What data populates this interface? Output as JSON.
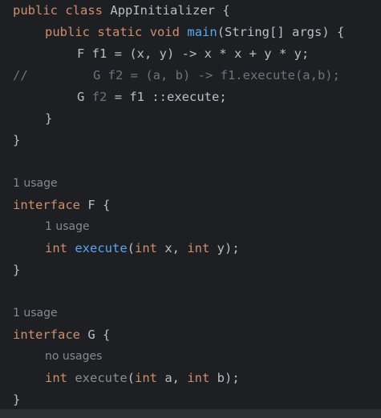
{
  "editor": {
    "lines": {
      "l1": {
        "kw1": "public",
        "kw2": "class",
        "name": "AppInitializer",
        "brace": "{"
      },
      "l2": {
        "kw1": "public",
        "kw2": "static",
        "kw3": "void",
        "fn": "main",
        "rest": "(String[] args) {"
      },
      "l3": {
        "text": "F f1 = (x, y) -> x * x + y * y;"
      },
      "l4": {
        "comment_mark": "//",
        "text": "G f2 = (a, b) -> f1.execute(a,b);"
      },
      "l5": {
        "type": "G",
        "var": "f2",
        "rest": " = f1 ::execute;"
      },
      "l6": {
        "text": "}"
      },
      "l7": {
        "text": "}"
      },
      "l8_hint": "1 usage",
      "l9": {
        "kw": "interface",
        "rest": " F {"
      },
      "l10_hint": "1 usage",
      "l11": {
        "kw1": "int",
        "fn": "execute",
        "p1": "(",
        "kw2": "int",
        "a": " x, ",
        "kw3": "int",
        "b": " y);"
      },
      "l12": {
        "text": "}"
      },
      "l13_hint": "1 usage",
      "l14": {
        "kw": "interface",
        "rest": " G {"
      },
      "l15_hint": "no usages",
      "l16": {
        "kw1": "int",
        "fn": "execute",
        "p1": "(",
        "kw2": "int",
        "a": " a, ",
        "kw3": "int",
        "b": " b);"
      },
      "l17": {
        "text": "}"
      }
    }
  },
  "colors": {
    "background": "#1e1f22",
    "keyword": "#cf8e6d",
    "method": "#56a8f5",
    "text": "#bcbec4",
    "hint": "#868a91",
    "unused": "#6f737a"
  }
}
